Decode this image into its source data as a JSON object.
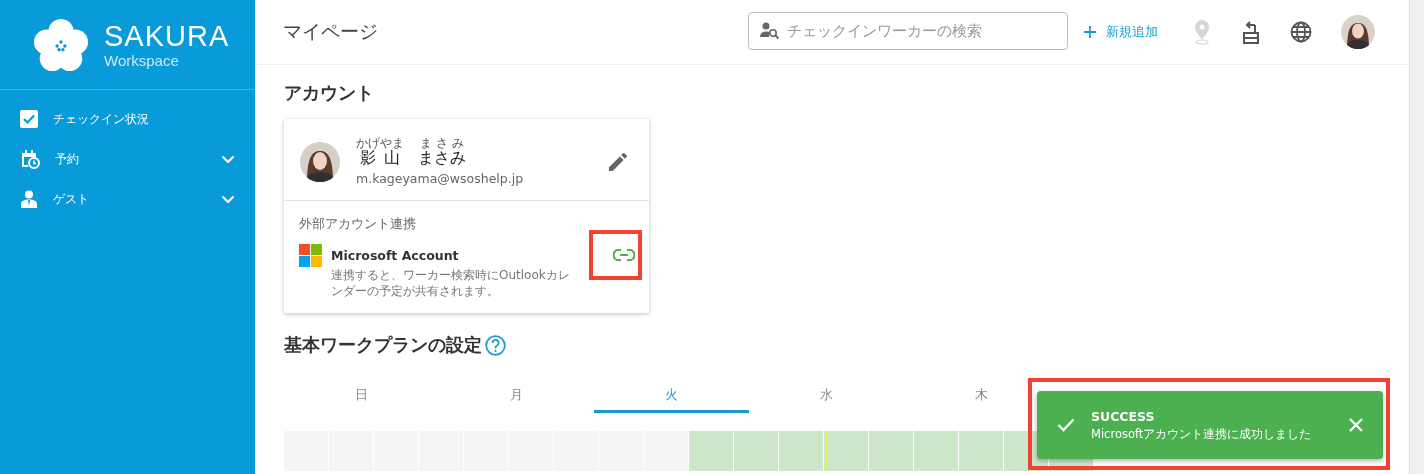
{
  "sidebar": {
    "logo": {
      "title": "SAKURA",
      "subtitle": "Workspace"
    },
    "items": [
      {
        "kind": "check",
        "label": "チェックイン状況",
        "expandable": false
      },
      {
        "kind": "calendar",
        "label": "予約",
        "expandable": true
      },
      {
        "kind": "guest",
        "label": "ゲスト",
        "expandable": true
      }
    ]
  },
  "header": {
    "title": "マイページ",
    "search": {
      "placeholder": "チェックインワーカーの検索"
    },
    "add_button": "新規追加",
    "location_disabled": true
  },
  "account": {
    "heading": "アカウント",
    "name": [
      {
        "text": "影山",
        "ruby": "かげやま"
      },
      {
        "text": "まさみ",
        "ruby": "まさみ"
      }
    ],
    "email": "m.kageyama@wsoshelp.jp",
    "external": {
      "heading": "外部アカウント連携",
      "service": "Microsoft Account",
      "description": "連携すると、ワーカー検索時にOutlookカレンダーの予定が共有されます。",
      "linked": true
    }
  },
  "work_plan": {
    "heading": "基本ワークプランの設定",
    "tabs": [
      {
        "label": "日",
        "selected": false
      },
      {
        "label": "月",
        "selected": false
      },
      {
        "label": "火",
        "selected": true
      },
      {
        "label": "水",
        "selected": false
      },
      {
        "label": "木",
        "selected": false
      }
    ],
    "cells": [
      {
        "on": false
      },
      {
        "on": false
      },
      {
        "on": false
      },
      {
        "on": false
      },
      {
        "on": false
      },
      {
        "on": false
      },
      {
        "on": false
      },
      {
        "on": false
      },
      {
        "on": false
      },
      {
        "on": true
      },
      {
        "on": true
      },
      {
        "on": true
      },
      {
        "on": true
      },
      {
        "on": true
      },
      {
        "on": true
      },
      {
        "on": true
      },
      {
        "on": true
      },
      {
        "on": true
      }
    ]
  },
  "toast": {
    "title": "SUCCESS",
    "message": "Microsoftアカウント連携に成功しました"
  }
}
